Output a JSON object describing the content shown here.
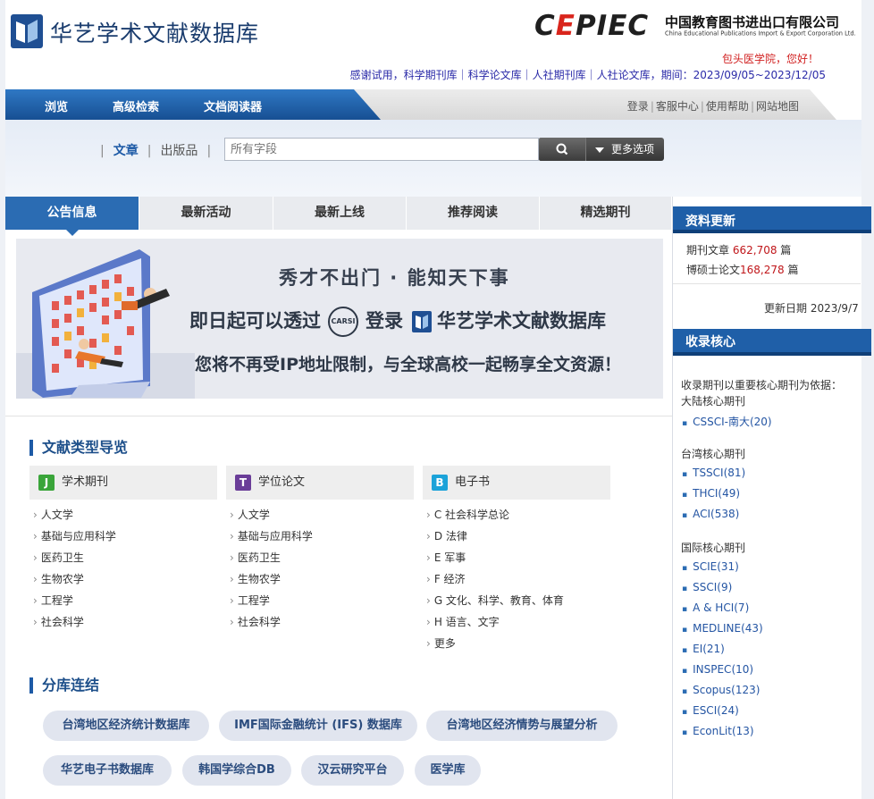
{
  "header": {
    "logo_text": "华艺学术文献数据库",
    "cepiec_word": "CEPIEC",
    "cepiec_cn": "中国教育图书进出口有限公司",
    "cepiec_en": "China Educational Publications Import & Export Corporation Ltd.",
    "greeting": "包头医学院，您好！",
    "notice": "感谢试用，科学期刊库｜科学论文库｜人社期刊库｜人社论文库，期间：2023/09/05~2023/12/05"
  },
  "nav": {
    "items": [
      "浏览",
      "高级检索",
      "文档阅读器"
    ],
    "top_links": [
      "登录",
      "客服中心",
      "使用帮助",
      "网站地图"
    ]
  },
  "search": {
    "tabs": [
      "文章",
      "出版品"
    ],
    "placeholder": "所有字段",
    "more_options": "更多选项"
  },
  "tabs": [
    "公告信息",
    "最新活动",
    "最新上线",
    "推荐阅读",
    "精选期刊"
  ],
  "banner": {
    "line1": "秀才不出门 · 能知天下事",
    "line2_a": "即日起可以透过",
    "carsi": "CARSI",
    "line2_b": "登录",
    "line2_c": "华艺学术文献数据库",
    "line3": "您将不再受IP地址限制，与全球高校一起畅享全文资源！"
  },
  "doc_nav": {
    "title": "文献类型导览",
    "categories": [
      {
        "badge": "J",
        "color": "#3aa53a",
        "label": "学术期刊",
        "items": [
          "人文学",
          "基础与应用科学",
          "医药卫生",
          "生物农学",
          "工程学",
          "社会科学"
        ]
      },
      {
        "badge": "T",
        "color": "#6a3d98",
        "label": "学位论文",
        "items": [
          "人文学",
          "基础与应用科学",
          "医药卫生",
          "生物农学",
          "工程学",
          "社会科学"
        ]
      },
      {
        "badge": "B",
        "color": "#1ca3d9",
        "label": "电子书",
        "items": [
          "C 社会科学总论",
          "D 法律",
          "E 军事",
          "F 经济",
          "G 文化、科学、教育、体育",
          "H 语言、文字",
          "更多"
        ]
      }
    ]
  },
  "branch": {
    "title": "分库连结",
    "links": [
      "台湾地区经济统计数据库",
      "IMF国际金融统计 (IFS) 数据库",
      "台湾地区经济情势与展望分析",
      "华艺电子书数据库",
      "韩国学综合DB",
      "汉云研究平台",
      "医学库"
    ]
  },
  "sidebar": {
    "update_title": "资料更新",
    "journal_label": "期刊文章",
    "journal_count": "662,708",
    "journal_unit": "篇",
    "thesis_label": "博硕士论文",
    "thesis_count": "168,278",
    "thesis_unit": "篇",
    "update_date": "更新日期 2023/9/7",
    "core_title": "收录核心",
    "core_intro_1": "收录期刊以重要核心期刊为依据：",
    "mainland_title": "大陆核心期刊",
    "mainland": [
      "CSSCI-南大(20)"
    ],
    "taiwan_title": "台湾核心期刊",
    "taiwan": [
      "TSSCI(81)",
      "THCI(49)",
      "ACI(538)"
    ],
    "intl_title": "国际核心期刊",
    "intl": [
      "SCIE(31)",
      "SSCI(9)",
      "A & HCI(7)",
      "MEDLINE(43)",
      "EI(21)",
      "INSPEC(10)",
      "Scopus(123)",
      "ESCI(24)",
      "EconLit(13)"
    ]
  },
  "colors": {
    "nav_blue": "#1f5fa8",
    "accent_red": "#d9251c",
    "link_blue": "#2455a3"
  }
}
